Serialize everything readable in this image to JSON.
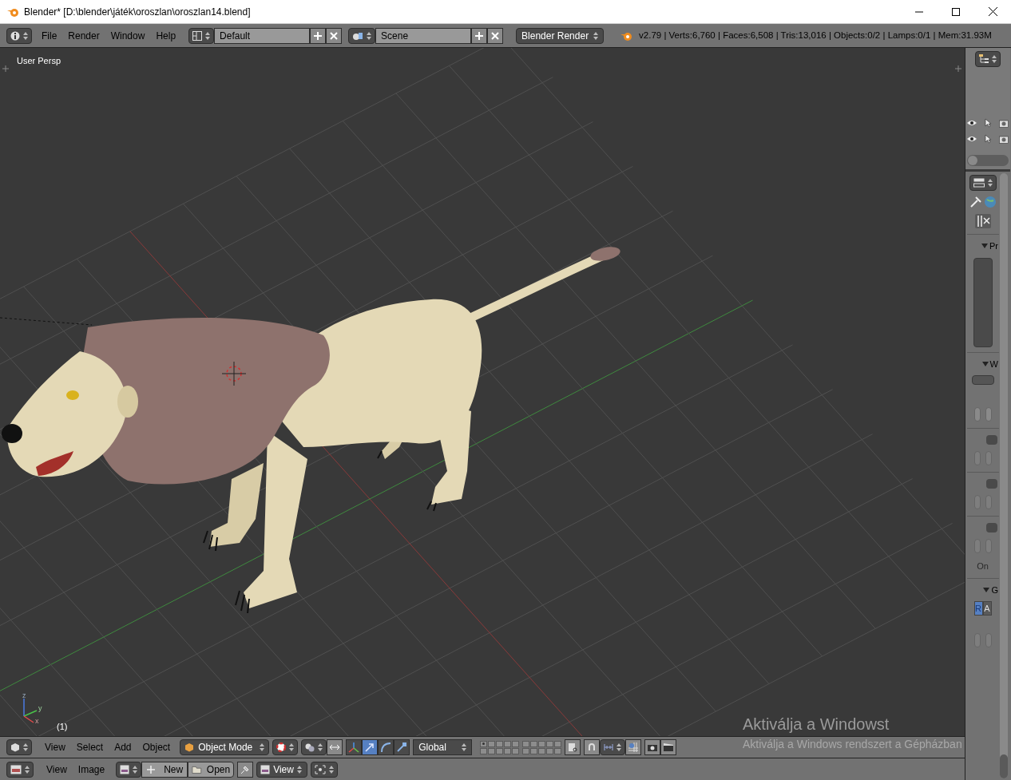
{
  "window": {
    "title": "Blender* [D:\\blender\\játék\\oroszlan\\oroszlan14.blend]"
  },
  "info_header": {
    "menus": [
      "File",
      "Render",
      "Window",
      "Help"
    ],
    "screen_layout": "Default",
    "scene": "Scene",
    "render_engine": "Blender Render",
    "stats": "v2.79 | Verts:6,760 | Faces:6,508 | Tris:13,016 | Objects:0/2 | Lamps:0/1 | Mem:31.93M"
  },
  "viewport": {
    "view_label": "User Persp",
    "frame_label": "(1)",
    "axis_labels": [
      "z",
      "y",
      "x"
    ]
  },
  "activation_notice": {
    "title": "Aktiválja a Windowst",
    "text": "Aktiválja a Windows rendszert a Gépházban"
  },
  "viewport_header": {
    "menus": [
      "View",
      "Select",
      "Add",
      "Object"
    ],
    "mode": "Object Mode",
    "orientation": "Global",
    "manipulators": [
      {
        "kind": "axes",
        "selected": false
      },
      {
        "kind": "translate",
        "selected": true
      },
      {
        "kind": "rotate",
        "selected": false
      },
      {
        "kind": "scale",
        "selected": false
      }
    ],
    "layers": [
      {
        "used": true
      },
      {
        "used": false
      },
      {
        "used": false
      },
      {
        "used": false
      },
      {
        "used": false
      },
      {
        "used": false
      },
      {
        "used": false
      },
      {
        "used": false
      },
      {
        "used": false
      },
      {
        "used": false
      },
      {
        "used": false
      },
      {
        "used": false
      },
      {
        "used": false
      },
      {
        "used": false
      },
      {
        "used": false
      },
      {
        "used": false
      },
      {
        "used": false
      },
      {
        "used": false
      },
      {
        "used": false
      },
      {
        "used": false
      }
    ]
  },
  "image_header": {
    "menus": [
      "View",
      "Image"
    ],
    "new_label": "New",
    "open_label": "Open",
    "view_mode": "View"
  },
  "outliner": {
    "rows": [
      {
        "visible": true
      },
      {
        "visible": true
      }
    ]
  },
  "properties": {
    "toggles": [
      {
        "on": false
      },
      {
        "on": false
      },
      {
        "on": false
      }
    ],
    "panels": [
      {
        "label": "Pr",
        "expanded": true
      },
      {
        "label": "W",
        "expanded": true
      },
      {
        "label": "G",
        "expanded": true
      }
    ],
    "on_label": "On",
    "channels": [
      {
        "label": "R",
        "selected": true
      },
      {
        "label": "A",
        "selected": false
      }
    ]
  }
}
